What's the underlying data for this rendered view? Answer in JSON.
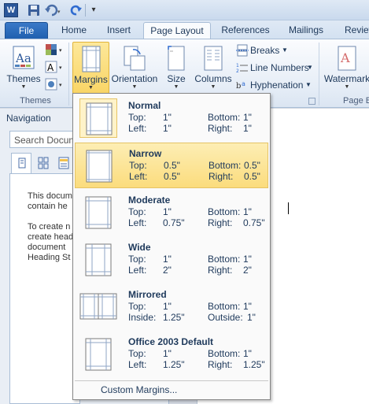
{
  "qat": {
    "logo": "W",
    "icons": [
      "word-logo",
      "save-icon",
      "undo-icon",
      "redo-icon",
      "customize-qat-icon"
    ]
  },
  "tabs": [
    {
      "label": "File"
    },
    {
      "label": "Home"
    },
    {
      "label": "Insert"
    },
    {
      "label": "Page Layout"
    },
    {
      "label": "References"
    },
    {
      "label": "Mailings"
    },
    {
      "label": "Review"
    }
  ],
  "ribbon": {
    "themes": {
      "label": "Themes",
      "group": "Themes"
    },
    "margins": {
      "label": "Margins"
    },
    "orientation": {
      "label": "Orientation"
    },
    "size": {
      "label": "Size"
    },
    "columns": {
      "label": "Columns"
    },
    "breaks": {
      "label": "Breaks"
    },
    "line_numbers": {
      "label": "Line Numbers"
    },
    "hyphenation": {
      "label": "Hyphenation"
    },
    "watermark": {
      "label": "Watermark"
    },
    "page_bg_group": "Page B"
  },
  "navigation": {
    "title": "Navigation",
    "search_placeholder": "Search Docume",
    "lines": [
      "This docum",
      "contain he",
      "",
      "To create n",
      "create head",
      "document",
      "Heading St"
    ]
  },
  "margins_menu": {
    "options": [
      {
        "name": "Normal",
        "k1": "Top:",
        "v1": "1\"",
        "k2": "Bottom:",
        "v2": "1\"",
        "k3": "Left:",
        "v3": "1\"",
        "k4": "Right:",
        "v4": "1\""
      },
      {
        "name": "Narrow",
        "k1": "Top:",
        "v1": "0.5\"",
        "k2": "Bottom:",
        "v2": "0.5\"",
        "k3": "Left:",
        "v3": "0.5\"",
        "k4": "Right:",
        "v4": "0.5\""
      },
      {
        "name": "Moderate",
        "k1": "Top:",
        "v1": "1\"",
        "k2": "Bottom:",
        "v2": "1\"",
        "k3": "Left:",
        "v3": "0.75\"",
        "k4": "Right:",
        "v4": "0.75\""
      },
      {
        "name": "Wide",
        "k1": "Top:",
        "v1": "1\"",
        "k2": "Bottom:",
        "v2": "1\"",
        "k3": "Left:",
        "v3": "2\"",
        "k4": "Right:",
        "v4": "2\""
      },
      {
        "name": "Mirrored",
        "k1": "Top:",
        "v1": "1\"",
        "k2": "Bottom:",
        "v2": "1\"",
        "k3": "Inside:",
        "v3": "1.25\"",
        "k4": "Outside:",
        "v4": "1\""
      },
      {
        "name": "Office 2003 Default",
        "k1": "Top:",
        "v1": "1\"",
        "k2": "Bottom:",
        "v2": "1\"",
        "k3": "Left:",
        "v3": "1.25\"",
        "k4": "Right:",
        "v4": "1.25\""
      }
    ],
    "custom_label": "Custom Margins..."
  },
  "colors": {
    "accent": "#2b579a",
    "highlight": "#fbdc7d",
    "text": "#1e395b"
  }
}
